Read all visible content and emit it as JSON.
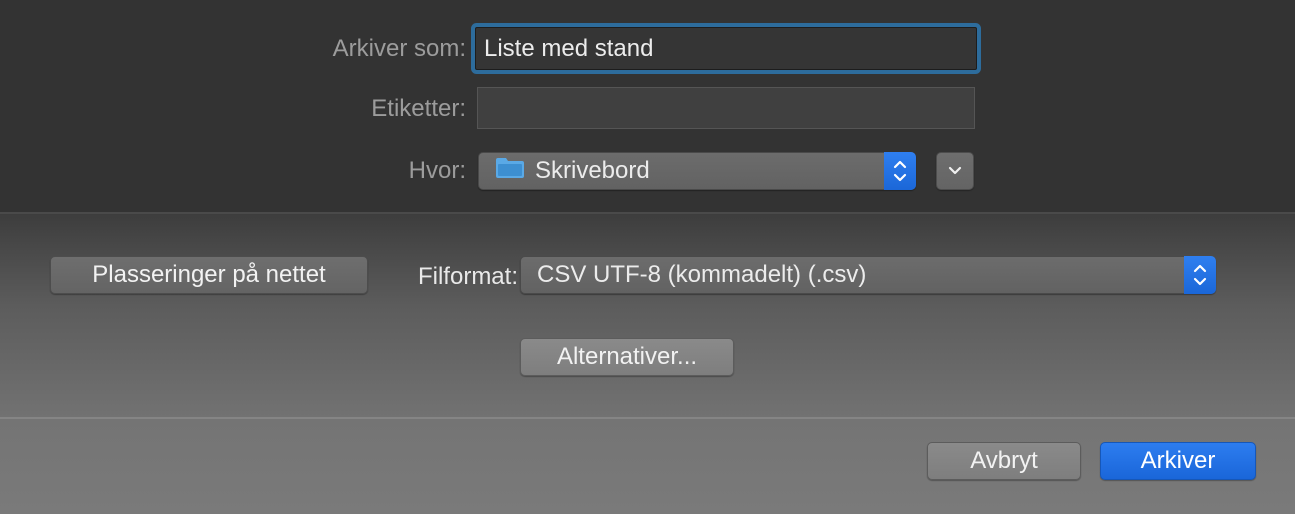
{
  "save_as": {
    "label": "Arkiver som:",
    "value": "Liste med stand"
  },
  "tags": {
    "label": "Etiketter:",
    "value": ""
  },
  "where": {
    "label": "Hvor:",
    "value": "Skrivebord",
    "icon": "folder-icon"
  },
  "online_locations_button": "Plasseringer på nettet",
  "file_format": {
    "label": "Filformat:",
    "value": "CSV UTF-8 (kommadelt) (.csv)"
  },
  "options_button": "Alternativer...",
  "cancel_button": "Avbryt",
  "save_button": "Arkiver",
  "colors": {
    "accent": "#1f6fe0",
    "focus_ring": "#2d6c9c"
  }
}
